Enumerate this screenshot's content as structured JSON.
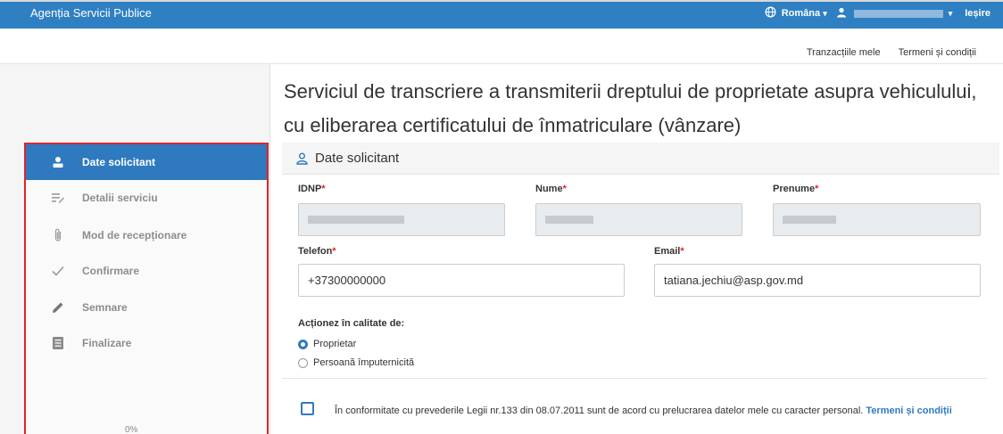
{
  "header": {
    "brand": "Agenția Servicii Publice",
    "language": "Româna",
    "logout": "Ieșire"
  },
  "subnav": {
    "transactions": "Tranzacțiile mele",
    "terms": "Termeni și condiții"
  },
  "page": {
    "title": "Serviciul de transcriere a transmiterii dreptului de proprietate asupra vehiculului, cu eliberarea certificatului de înmatriculare (vânzare)"
  },
  "steps": [
    {
      "label": "Date solicitant",
      "icon": "person-icon",
      "active": true
    },
    {
      "label": "Detalii serviciu",
      "icon": "list-edit-icon",
      "active": false
    },
    {
      "label": "Mod de recepționare",
      "icon": "paperclip-icon",
      "active": false
    },
    {
      "label": "Confirmare",
      "icon": "checkmark-icon",
      "active": false
    },
    {
      "label": "Semnare",
      "icon": "pencil-icon",
      "active": false
    },
    {
      "label": "Finalizare",
      "icon": "document-icon",
      "active": false
    }
  ],
  "progress": {
    "value": 0,
    "label": "0%"
  },
  "section": {
    "title": "Date solicitant",
    "icon": "person-icon"
  },
  "form": {
    "idnp_label": "IDNP",
    "nume_label": "Nume",
    "prenume_label": "Prenume",
    "telefon_label": "Telefon",
    "telefon_value": "+37300000000",
    "email_label": "Email",
    "email_value": "tatiana.jechiu@asp.gov.md",
    "required_mark": "*"
  },
  "role": {
    "title": "Acționez în calitate de:",
    "options": [
      {
        "label": "Proprietar",
        "selected": true
      },
      {
        "label": "Persoană împuternicită",
        "selected": false
      }
    ]
  },
  "consent": {
    "text": "În conformitate cu prevederile Legii nr.133 din 08.07.2011 sunt de acord cu prelucrarea datelor mele cu caracter personal.",
    "link": "Termeni și condiții",
    "checked": false
  },
  "colors": {
    "primary": "#2f7abf",
    "highlight_border": "#e0242d"
  }
}
